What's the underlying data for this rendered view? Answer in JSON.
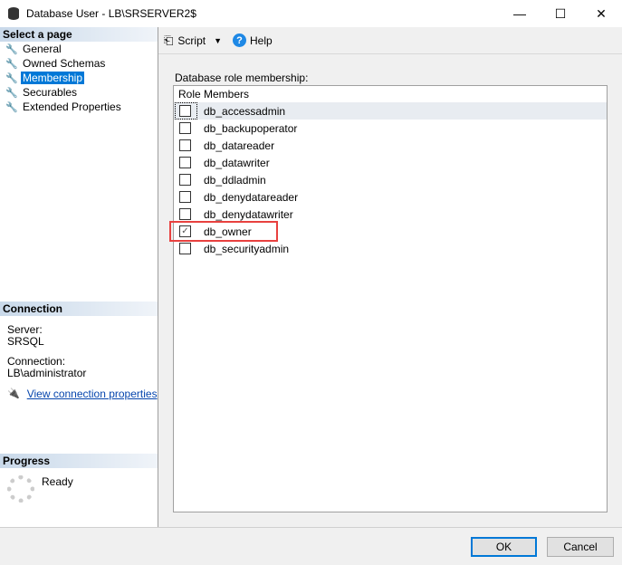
{
  "window": {
    "title": "Database User - LB\\SRSERVER2$",
    "minimize": "—",
    "maximize": "☐",
    "close": "✕"
  },
  "sidebar": {
    "header": "Select a page",
    "items": [
      {
        "label": "General"
      },
      {
        "label": "Owned Schemas"
      },
      {
        "label": "Membership",
        "selected": true
      },
      {
        "label": "Securables"
      },
      {
        "label": "Extended Properties"
      }
    ]
  },
  "connection": {
    "header": "Connection",
    "server_label": "Server:",
    "server": "SRSQL",
    "connection_label": "Connection:",
    "connection": "LB\\administrator",
    "link": "View connection properties"
  },
  "progress": {
    "header": "Progress",
    "status": "Ready"
  },
  "toolbar": {
    "script": "Script",
    "help": "Help"
  },
  "membership": {
    "label": "Database role membership:",
    "column": "Role Members",
    "roles": [
      {
        "name": "db_accessadmin",
        "checked": false
      },
      {
        "name": "db_backupoperator",
        "checked": false
      },
      {
        "name": "db_datareader",
        "checked": false
      },
      {
        "name": "db_datawriter",
        "checked": false
      },
      {
        "name": "db_ddladmin",
        "checked": false
      },
      {
        "name": "db_denydatareader",
        "checked": false
      },
      {
        "name": "db_denydatawriter",
        "checked": false
      },
      {
        "name": "db_owner",
        "checked": true
      },
      {
        "name": "db_securityadmin",
        "checked": false
      }
    ]
  },
  "buttons": {
    "ok": "OK",
    "cancel": "Cancel"
  },
  "colors": {
    "highlight": "#e8413f",
    "selection": "#0078d7"
  }
}
